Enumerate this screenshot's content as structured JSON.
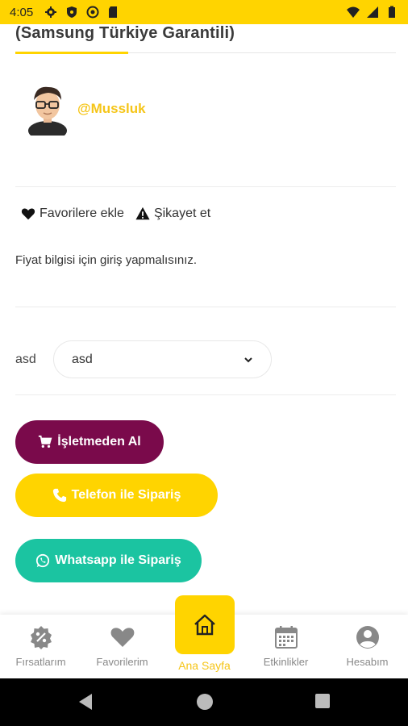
{
  "status_bar": {
    "time": "4:05",
    "left_icons": [
      "gear-icon",
      "shield-icon",
      "at-icon",
      "sd-card-icon"
    ],
    "right_icons": [
      "wifi-icon",
      "signal-icon",
      "battery-icon"
    ]
  },
  "product": {
    "title": "(Samsung Türkiye Garantili)"
  },
  "seller": {
    "username": "@Mussluk"
  },
  "actions": {
    "favorite": "Favorilere ekle",
    "complaint": "Şikayet et"
  },
  "price_info": "Fiyat bilgisi için giriş yapmalısınız.",
  "variant": {
    "label": "asd",
    "selected": "asd"
  },
  "buttons": {
    "buy": "İşletmeden Al",
    "phone": "Telefon ile Sipariş",
    "whatsapp": "Whatsapp ile Sipariş"
  },
  "bottom_nav": {
    "items": [
      {
        "label": "Fırsatlarım",
        "icon": "discount-badge-icon"
      },
      {
        "label": "Favorilerim",
        "icon": "heart-icon"
      },
      {
        "label": "Ana Sayfa",
        "icon": "home-icon",
        "active": true
      },
      {
        "label": "Etkinlikler",
        "icon": "calendar-icon"
      },
      {
        "label": "Hesabım",
        "icon": "account-icon"
      }
    ]
  },
  "colors": {
    "accent_yellow": "#FFD400",
    "buy_purple": "#7A0A4B",
    "whatsapp_green": "#1BC4A1",
    "seller_name": "#F5C518"
  }
}
